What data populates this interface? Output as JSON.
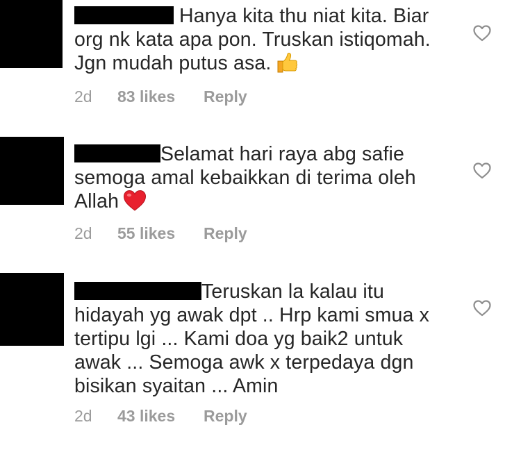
{
  "comments": [
    {
      "lines": [
        "Hanya kita thu niat kita. Biar",
        "org nk kata apa pon. Truskan istiqomah.",
        "Jgn mudah putus asa."
      ],
      "emoji": "thumbs-up-icon",
      "time": "2d",
      "likes": "83 likes",
      "reply": "Reply"
    },
    {
      "lines": [
        "Selamat hari raya abg safie",
        "semoga amal kebaikkan di terima oleh",
        "Allah"
      ],
      "emoji": "red-heart-icon",
      "time": "2d",
      "likes": "55 likes",
      "reply": "Reply"
    },
    {
      "lines": [
        "Teruskan la kalau itu",
        "hidayah yg awak dpt .. Hrp kami smua x",
        "tertipu lgi ... Kami doa yg baik2 untuk",
        "awak ... Semoga awk x terpedaya dgn",
        "bisikan syaitan ... Amin"
      ],
      "emoji": "",
      "time": "2d",
      "likes": "43 likes",
      "reply": "Reply"
    }
  ],
  "colors": {
    "text": "#262626",
    "meta": "#9b9b9b",
    "redaction": "#000000",
    "heart_outline": "#8e8e8e"
  }
}
